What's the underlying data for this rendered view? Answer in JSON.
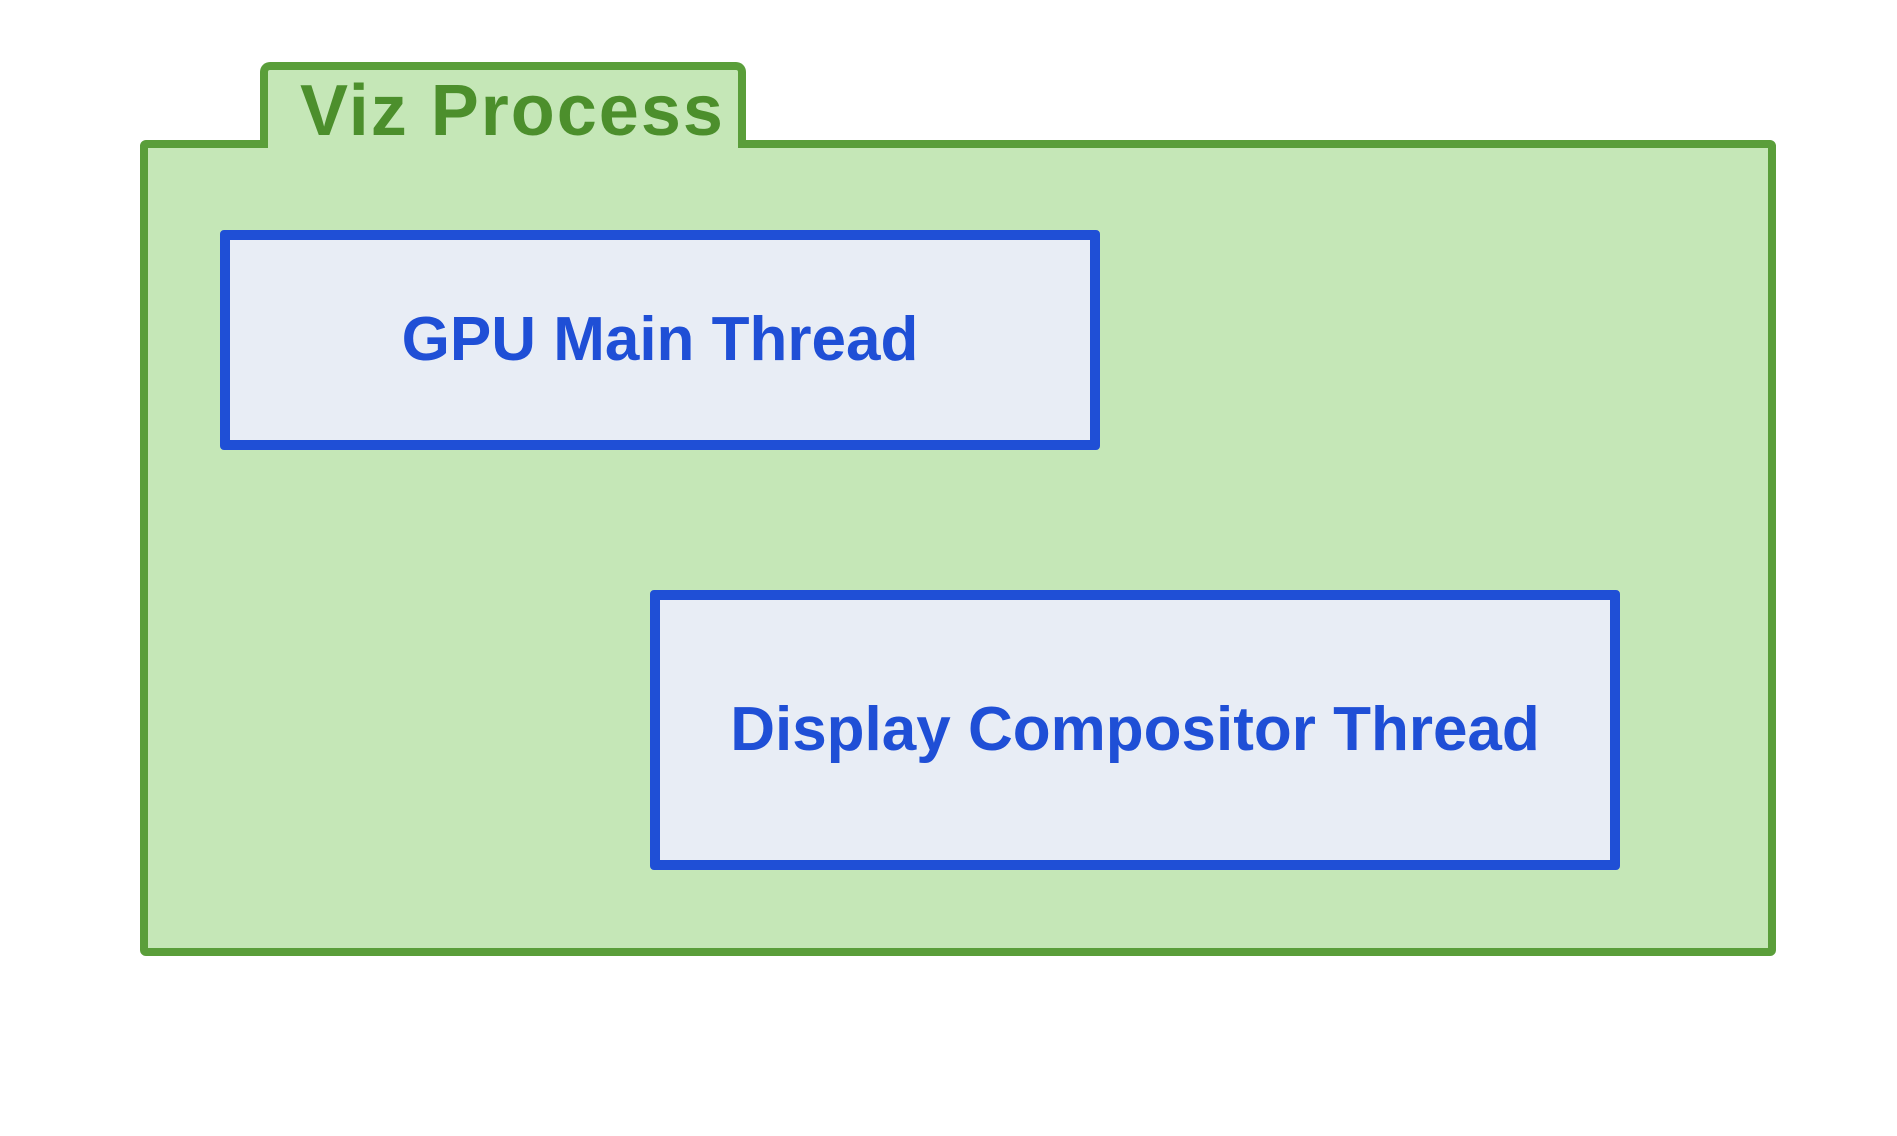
{
  "diagram": {
    "title": "Viz Process",
    "threads": {
      "gpu_main": "GPU Main Thread",
      "display_compositor": "Display Compositor Thread"
    },
    "colors": {
      "container_fill": "#c5e7b7",
      "container_stroke": "#5a9e3a",
      "thread_fill": "#e8edf5",
      "thread_stroke": "#1f4fd6"
    }
  }
}
